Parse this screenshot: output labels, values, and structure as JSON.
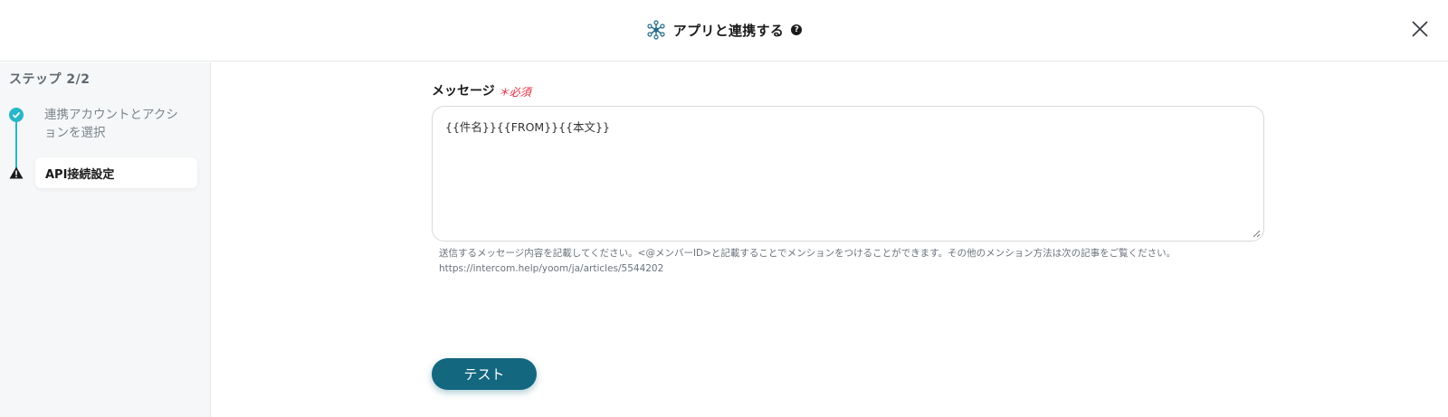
{
  "header": {
    "title": "アプリと連携する",
    "help_icon": "?",
    "accent": "#1f6b8a"
  },
  "sidebar": {
    "step_label": "ステップ 2/2",
    "steps": [
      {
        "label": "連携アカウントとアクションを選択",
        "status": "complete",
        "icon": "check-icon"
      },
      {
        "label": "API接続設定",
        "status": "warning",
        "icon": "warning-icon"
      }
    ]
  },
  "form": {
    "message_label": "メッセージ",
    "required_text": "＊必須",
    "message_value": "{{件名}}{{FROM}}{{本文}}",
    "help_line1": "送信するメッセージ内容を記載してください。<@メンバーID>と記載することでメンションをつけることができます。その他のメンション方法は次の記事をご覧ください。",
    "help_line2": "https://intercom.help/yoom/ja/articles/5544202"
  },
  "actions": {
    "test_label": "テスト"
  },
  "colors": {
    "step_accent": "#29b6c9",
    "button_bg": "#13677f",
    "required": "#e0283c"
  }
}
